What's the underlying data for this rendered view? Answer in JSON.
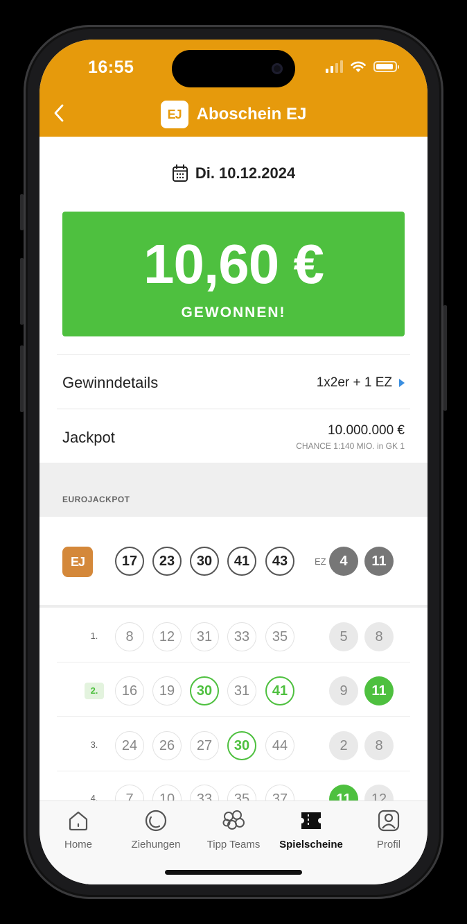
{
  "status_bar": {
    "time": "16:55"
  },
  "header": {
    "title": "Aboschein EJ",
    "logo_text": "EJ",
    "back_icon": "chevron-left-icon"
  },
  "draw": {
    "date": "Di. 10.12.2024"
  },
  "win": {
    "amount": "10,60 €",
    "label": "GEWONNEN!"
  },
  "details": {
    "gewinn_label": "Gewinndetails",
    "gewinn_value": "1x2er + 1 EZ",
    "jackpot_label": "Jackpot",
    "jackpot_value": "10.000.000 €",
    "jackpot_chance": "CHANCE 1:140 MIO. in GK 1"
  },
  "section": {
    "label": "EUROJACKPOT"
  },
  "winning_numbers": {
    "logo_text": "EJ",
    "main": [
      "17",
      "23",
      "30",
      "41",
      "43"
    ],
    "ez_label": "EZ",
    "euro": [
      "4",
      "11"
    ]
  },
  "tips": [
    {
      "index": "1.",
      "won": false,
      "main": [
        {
          "n": "8",
          "hit": false
        },
        {
          "n": "12",
          "hit": false
        },
        {
          "n": "31",
          "hit": false
        },
        {
          "n": "33",
          "hit": false
        },
        {
          "n": "35",
          "hit": false
        }
      ],
      "euro": [
        {
          "n": "5",
          "hit": false
        },
        {
          "n": "8",
          "hit": false
        }
      ]
    },
    {
      "index": "2.",
      "won": true,
      "main": [
        {
          "n": "16",
          "hit": false
        },
        {
          "n": "19",
          "hit": false
        },
        {
          "n": "30",
          "hit": true
        },
        {
          "n": "31",
          "hit": false
        },
        {
          "n": "41",
          "hit": true
        }
      ],
      "euro": [
        {
          "n": "9",
          "hit": false
        },
        {
          "n": "11",
          "hit": true
        }
      ]
    },
    {
      "index": "3.",
      "won": false,
      "main": [
        {
          "n": "24",
          "hit": false
        },
        {
          "n": "26",
          "hit": false
        },
        {
          "n": "27",
          "hit": false
        },
        {
          "n": "30",
          "hit": true
        },
        {
          "n": "44",
          "hit": false
        }
      ],
      "euro": [
        {
          "n": "2",
          "hit": false
        },
        {
          "n": "8",
          "hit": false
        }
      ]
    },
    {
      "index": "4.",
      "won": false,
      "main": [
        {
          "n": "7",
          "hit": false
        },
        {
          "n": "10",
          "hit": false
        },
        {
          "n": "33",
          "hit": false
        },
        {
          "n": "35",
          "hit": false
        },
        {
          "n": "37",
          "hit": false
        }
      ],
      "euro": [
        {
          "n": "11",
          "hit": true
        },
        {
          "n": "12",
          "hit": false
        }
      ]
    }
  ],
  "tabbar": {
    "items": [
      {
        "label": "Home",
        "icon": "home-icon",
        "active": false
      },
      {
        "label": "Ziehungen",
        "icon": "draw-icon",
        "active": false
      },
      {
        "label": "Tipp Teams",
        "icon": "teams-icon",
        "active": false
      },
      {
        "label": "Spielscheine",
        "icon": "ticket-icon",
        "active": true
      },
      {
        "label": "Profil",
        "icon": "profile-icon",
        "active": false
      }
    ]
  },
  "colors": {
    "header": "#e69a0c",
    "win": "#4ec03f",
    "hit": "#4ec03f",
    "logo": "#d4883a"
  }
}
